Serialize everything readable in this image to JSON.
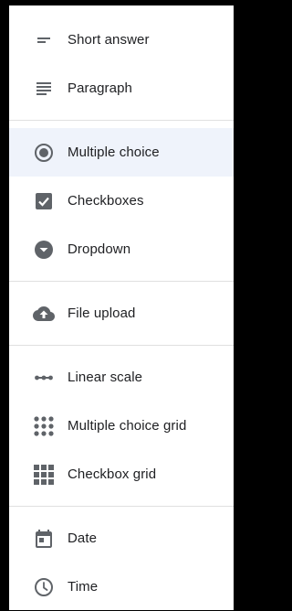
{
  "menu": {
    "items": [
      {
        "label": "Short answer",
        "icon": "short-text-icon"
      },
      {
        "label": "Paragraph",
        "icon": "paragraph-icon"
      },
      {
        "label": "Multiple choice",
        "icon": "radio-button-icon",
        "selected": true
      },
      {
        "label": "Checkboxes",
        "icon": "checkbox-icon"
      },
      {
        "label": "Dropdown",
        "icon": "dropdown-icon"
      },
      {
        "label": "File upload",
        "icon": "cloud-upload-icon"
      },
      {
        "label": "Linear scale",
        "icon": "linear-scale-icon"
      },
      {
        "label": "Multiple choice grid",
        "icon": "dot-grid-icon"
      },
      {
        "label": "Checkbox grid",
        "icon": "square-grid-icon"
      },
      {
        "label": "Date",
        "icon": "calendar-icon"
      },
      {
        "label": "Time",
        "icon": "clock-icon"
      }
    ]
  },
  "colors": {
    "icon": "#5f6368",
    "selected_background": "#eff3fb",
    "divider": "#e0e0e0",
    "text": "#202124"
  }
}
